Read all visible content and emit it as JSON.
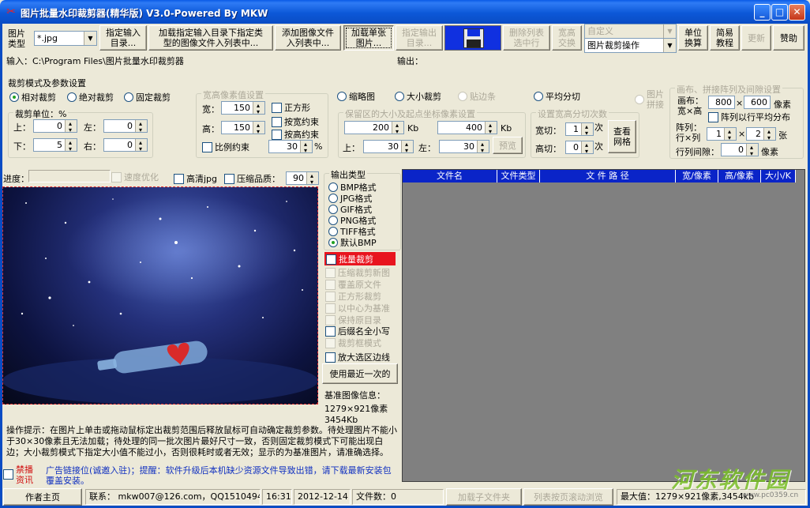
{
  "window": {
    "title": "图片批量水印裁剪器(精华版) V3.0-Powered By MKW"
  },
  "toolbar": {
    "img_type_label": "图片\n类型",
    "img_type_value": "*.jpg",
    "btn_set_input": "指定输入\n目录...",
    "btn_load_dir": "加载指定输入目录下指定类\n型的图像文件入列表中...",
    "btn_add_files": "添加图像文件\n入列表中...",
    "btn_load_single": "加载单张\n图片...",
    "btn_set_output": "指定输出\n目录...",
    "btn_delete_list": "删除列表\n选中行",
    "btn_width_swap": "宽高\n交换",
    "custom_select": "自定义",
    "op_select": "图片裁剪操作",
    "btn_unit": "单位\n换算",
    "btn_tutorial": "简易\n教程",
    "btn_update": "更新",
    "btn_donate": "赞助"
  },
  "paths": {
    "input_label": "输入：C:\\Program Files\\图片批量水印裁剪器",
    "output_label": "输出："
  },
  "crop": {
    "section_title": "裁剪模式及参数设置",
    "mode_relative": "相对裁剪",
    "mode_absolute": "绝对裁剪",
    "mode_fixed": "固定裁剪",
    "unit_group": "裁剪单位：%",
    "top": "上：",
    "left": "左：",
    "bottom": "下：",
    "right": "右：",
    "top_val": "0",
    "left_val": "0",
    "bottom_val": "5",
    "right_val": "0",
    "wh_group": "宽高像素值设置",
    "width": "宽：",
    "height": "高：",
    "width_val": "150",
    "height_val": "150",
    "square": "正方形",
    "keep_w": "按宽约束",
    "keep_h": "按高约束",
    "ratio": "比例约束",
    "ratio_val": "30",
    "ratio_unit": "%",
    "thumb": "缩略图",
    "size_crop": "大小裁剪",
    "paste_edge": "贴边条",
    "avg_split": "平均分切",
    "pic_join": "图片\n拼接",
    "keep_group": "保留区的大小及起点坐标像素设置",
    "kb_min": "200",
    "kb_min_unit": "Kb",
    "kb_max": "400",
    "kb_max_unit": "Kb",
    "k_top": "上：",
    "k_top_val": "30",
    "k_left": "左：",
    "k_left_val": "30",
    "preview_btn": "预览",
    "split_group": "设置宽高分切次数",
    "w_cut": "宽切：",
    "w_cut_val": "1",
    "times": "次",
    "h_cut": "高切：",
    "h_cut_val": "0",
    "times2": "次",
    "view_grid": "查看\n网格"
  },
  "canvas": {
    "group": "画布、拼接阵列及间隙设置",
    "canvas_label": "画布：\n宽×高",
    "cw": "800",
    "times": "×",
    "ch": "600",
    "px": "像素",
    "avg_dist": "阵列以行平均分布",
    "array_label": "阵列：\n行×列",
    "rows": "1",
    "times2": "×",
    "cols": "2",
    "sheets": "张",
    "gap_label": "行列间隙：",
    "gap_val": "0",
    "gap_px": "像素"
  },
  "progress": {
    "label": "进度：",
    "speed": "速度优化",
    "hd_jpg": "高清jpg",
    "compress": "压缩品质：",
    "quality": "90"
  },
  "output": {
    "group": "输出类型",
    "types": [
      "BMP格式",
      "JPG格式",
      "GIF格式",
      "PNG格式",
      "TIFF格式",
      "默认BMP"
    ],
    "batch_crop": "批量裁剪",
    "options": [
      "压缩裁剪新图",
      "覆盖原文件",
      "正方形裁剪",
      "以中心为基准",
      "保持原目录",
      "后缀名全小写",
      "裁剪框模式",
      "放大选区边线"
    ],
    "use_recent": "使用最近一次的",
    "base_info_title": "基准图像信息：",
    "base_info_size": "1279×921像素",
    "base_info_kb": "3454Kb"
  },
  "list": {
    "columns": [
      "文件名",
      "文件类型",
      "文 件 路 径",
      "宽/像素",
      "高/像素",
      "大小/K"
    ]
  },
  "tips": {
    "text": "操作提示：在图片上单击或拖动鼠标定出裁剪范围后释放鼠标可自动确定裁剪参数。待处理图片不能小于30×30像素且无法加载；待处理的同一批次图片最好尺寸一致，否则固定裁剪模式下可能出现白边；大小裁剪模式下指定大小值不能过小，否则很耗时或者无效；显示的为基准图片，请准确选择。",
    "ad_prefix": "禁播\n资讯",
    "ad_text": "广告链接位(诚邀入驻)；提醒：软件升级后本机缺少资源文件导致出错，请下载最新安装包覆盖安装。"
  },
  "status": {
    "home": "作者主页",
    "contact": "联系： mkw007@126.com，QQ15104946",
    "time": "16:31",
    "date": "2012-12-14",
    "file_count": "文件数：0",
    "load_sub": "加载子文件夹",
    "list_scroll": "列表按页滚动浏览",
    "max_value": "最大值：1279×921像素,3454kb"
  },
  "watermark": {
    "text": "河东软件园",
    "url": "www.pc0359.cn"
  }
}
